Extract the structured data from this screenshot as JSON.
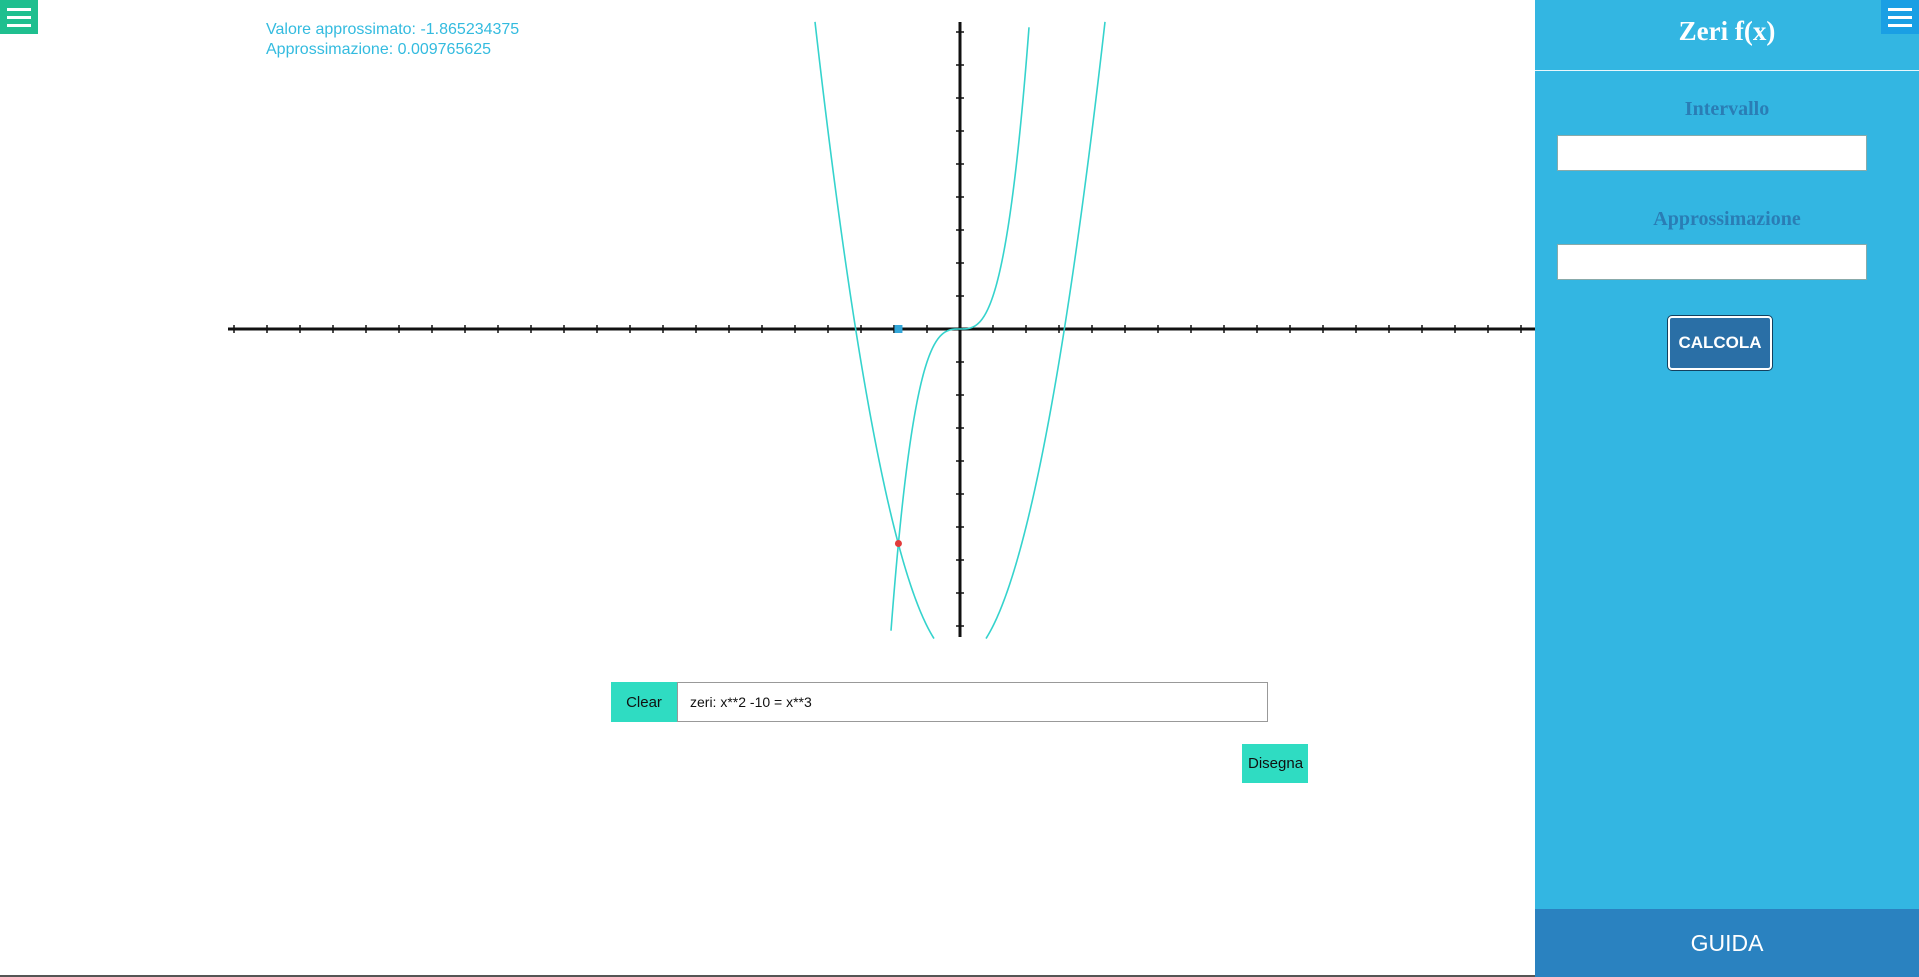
{
  "left_menu": {
    "icon": "hamburger-icon",
    "color": "#1fbf8f"
  },
  "info": {
    "approx_value": "Valore approssimato: -1.865234375",
    "approximation": "Approssimazione: 0.009765625"
  },
  "canvas": {
    "curve_color": "#35d3cd",
    "axis_color": "#111111",
    "solution_x": -1.865234375,
    "solution_y": -6.5,
    "marker_color": "#e23b3b",
    "root_marker_color": "#33a7d9",
    "functions": [
      "x**2 -10",
      "x**3"
    ]
  },
  "controls": {
    "clear_label": "Clear",
    "expression_value": "zeri: x**2 -10 = x**3",
    "draw_label": "Disegna"
  },
  "panel": {
    "title": "Zeri f(x)",
    "interval_label": "Intervallo",
    "interval_value": "",
    "approx_label": "Approssimazione",
    "approx_value": "",
    "calc_label": "CALCOLA",
    "guide_label": "GUIDA",
    "menu_icon": "hamburger-icon",
    "colors": {
      "background": "#33b6e2",
      "guide": "#2a82c0",
      "button": "#2a6fa6"
    }
  }
}
